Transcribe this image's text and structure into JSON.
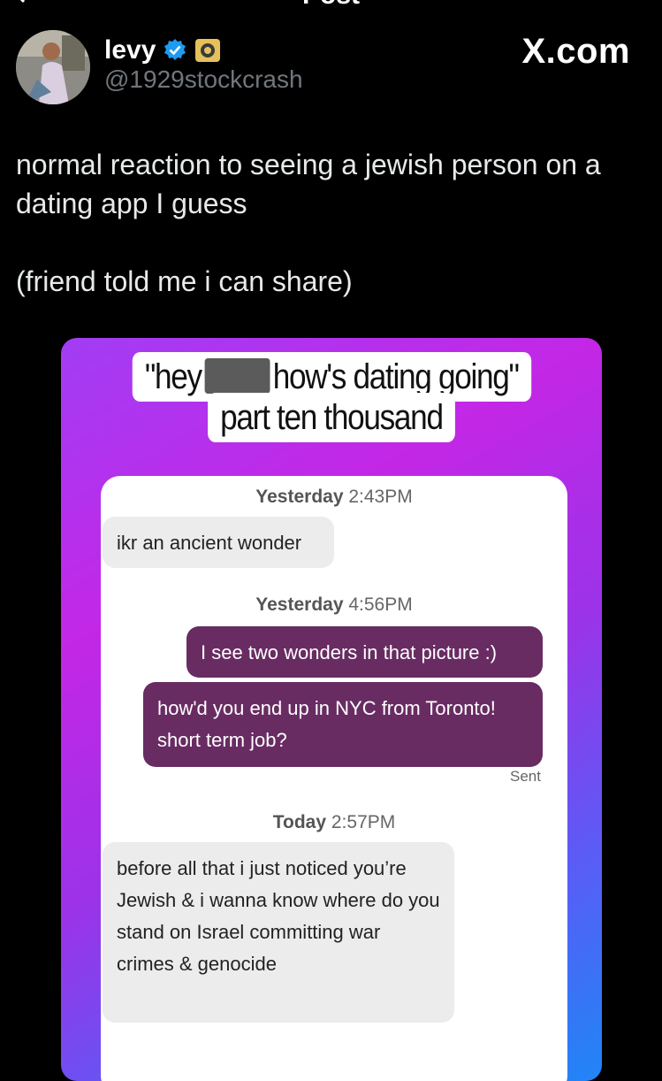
{
  "header": {
    "title": "Post",
    "site": "X.com"
  },
  "author": {
    "name": "levy",
    "handle": "@1929stockcrash"
  },
  "post": {
    "text": "normal reaction to seeing a jewish person on a\ndating app I guess\n\n(friend told me i can share)"
  },
  "media": {
    "caption_line1_a": "\"hey",
    "caption_line1_b": "how's dating going\"",
    "caption_line2": "part ten thousand",
    "messages": {
      "stamp1_day": "Yesterday",
      "stamp1_time": "2:43PM",
      "msg1": "ikr an ancient wonder",
      "stamp2_day": "Yesterday",
      "stamp2_time": "4:56PM",
      "msg2": "I see two wonders in that picture :)",
      "msg3": "how'd you end up in NYC from Toronto! short term job?",
      "sent_label": "Sent",
      "stamp3_day": "Today",
      "stamp3_time": "2:57PM",
      "msg4": "before all that i just noticed you’re Jewish & i wanna know where do you stand on Israel committing war crimes & genocide"
    }
  },
  "colors": {
    "background": "#000000",
    "verified": "#1d9bf0",
    "sent_bubble": "#682c62",
    "received_bubble": "#ececec"
  }
}
